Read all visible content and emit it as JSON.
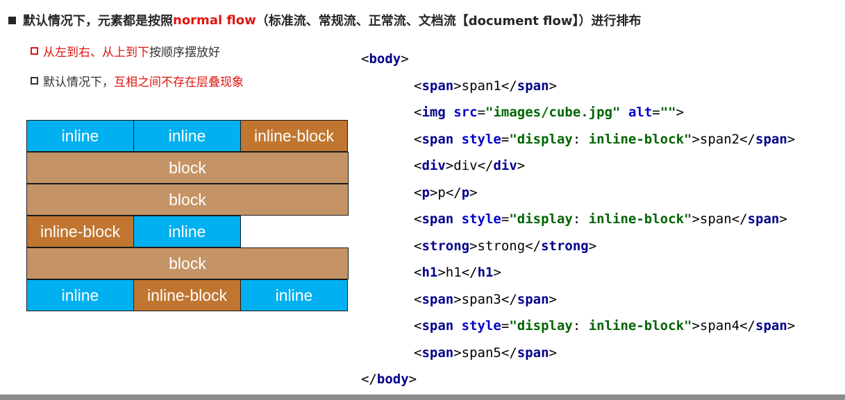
{
  "heading": {
    "prefix": "默认情况下，元素都是按照",
    "highlight": "normal flow",
    "suffix": "（标准流、常规流、正常流、文档流【document flow】）进行排布"
  },
  "points": [
    {
      "highlight": "从左到右、从上到下",
      "rest": "按顺序摆放好"
    },
    {
      "prefix": "默认情况下，",
      "highlight": "互相之间不存在层叠现象"
    }
  ],
  "colors": {
    "inline": "#00b0f0",
    "inline_block": "#c07630",
    "block": "#c59466",
    "highlight": "#e0140f"
  },
  "layout_rows": [
    [
      "inline",
      "inline",
      "inline-block"
    ],
    [
      "block"
    ],
    [
      "block"
    ],
    [
      "inline-block",
      "inline"
    ],
    [
      "block"
    ],
    [
      "inline",
      "inline-block",
      "inline"
    ]
  ],
  "code": {
    "open_body": "body",
    "close_body": "body",
    "lines": [
      {
        "tag": "span",
        "content": "span1"
      },
      {
        "tag": "img",
        "attrs": "src=\"images/cube.jpg\" alt=\"\"",
        "self_closing": true
      },
      {
        "tag": "span",
        "style": "display",
        "style_value": "inline-block",
        "content": "span2"
      },
      {
        "tag": "div",
        "content": "div"
      },
      {
        "tag": "p",
        "content": "p"
      },
      {
        "tag": "span",
        "style": "display",
        "style_value": "inline-block",
        "content": "span"
      },
      {
        "tag": "strong",
        "content": "strong"
      },
      {
        "tag": "h1",
        "content": "h1"
      },
      {
        "tag": "span",
        "content": "span3"
      },
      {
        "tag": "span",
        "style": "display",
        "style_value": "inline-block",
        "content": "span4"
      },
      {
        "tag": "span",
        "content": "span5"
      }
    ]
  }
}
